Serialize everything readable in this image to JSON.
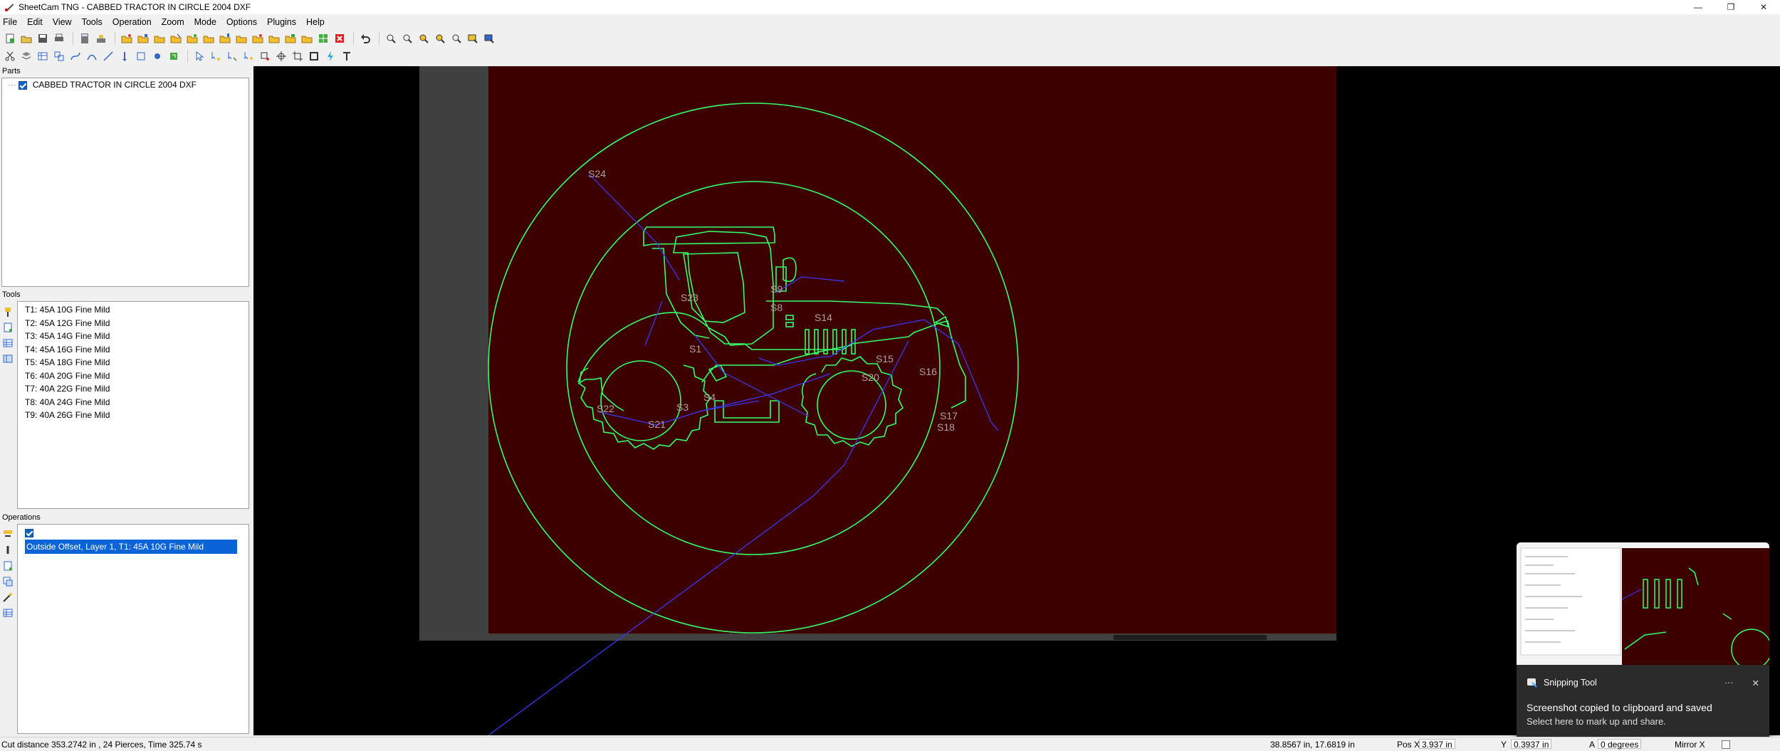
{
  "window": {
    "title": "SheetCam TNG - CABBED TRACTOR IN CIRCLE 2004 DXF"
  },
  "menu": [
    "File",
    "Edit",
    "View",
    "Tools",
    "Operation",
    "Zoom",
    "Mode",
    "Options",
    "Plugins",
    "Help"
  ],
  "panels": {
    "parts": {
      "title": "Parts",
      "items": [
        "CABBED TRACTOR IN CIRCLE 2004 DXF"
      ]
    },
    "tools": {
      "title": "Tools",
      "items": [
        "T1: 45A 10G Fine Mild",
        "T2: 45A 12G Fine Mild",
        "T3: 45A 14G Fine Mild",
        "T4: 45A 16G Fine Mild",
        "T5: 45A 18G Fine Mild",
        "T6: 40A 20G Fine Mild",
        "T7: 40A 22G Fine Mild",
        "T8: 40A 24G Fine Mild",
        "T9: 40A 26G Fine Mild"
      ]
    },
    "operations": {
      "title": "Operations",
      "items": [
        "Outside Offset, Layer 1, T1: 45A 10G Fine Mild"
      ]
    }
  },
  "canvas": {
    "labels": [
      "S24",
      "S23",
      "S9",
      "S8",
      "S14",
      "S1",
      "S15",
      "S16",
      "S20",
      "S22",
      "S21",
      "S4",
      "S3",
      "S17",
      "S18"
    ],
    "colors": {
      "sheet": "#3d0000",
      "outline": "#33ff66",
      "rapid": "#3a3aff"
    }
  },
  "status": {
    "cut_info": "Cut distance 353.2742 in , 24 Pierces, Time 325.74 s",
    "coords": "38.8567 in, 17.6819 in",
    "posx_label": "Pos X",
    "posx_value": "3.937 in",
    "y_label": "Y",
    "y_value": "0.3937 in",
    "a_label": "A",
    "a_value": "0 degrees",
    "mirror_label": "Mirror X"
  },
  "toast": {
    "app": "Snipping Tool",
    "message": "Screenshot copied to clipboard and saved",
    "sub": "Select here to mark up and share.",
    "more": "···",
    "close": "✕"
  }
}
